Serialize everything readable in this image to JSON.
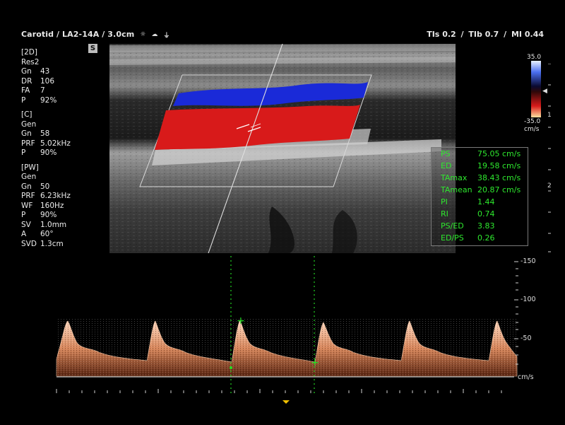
{
  "header": {
    "probe_info": "Carotid / LA2-14A / 3.0cm",
    "icons": [
      "harmonic-icon",
      "cloud-icon",
      "probe-icon"
    ],
    "indices": [
      {
        "label": "TIs",
        "value": "0.2"
      },
      {
        "label": "TIb",
        "value": "0.7"
      },
      {
        "label": "MI",
        "value": "0.44"
      }
    ]
  },
  "side_marker": "S",
  "params": [
    {
      "title": "[2D]",
      "preset": "Res2",
      "rows": [
        {
          "k": "Gn",
          "v": "43"
        },
        {
          "k": "DR",
          "v": "106"
        },
        {
          "k": "FA",
          "v": "7"
        },
        {
          "k": "P",
          "v": "92%"
        }
      ]
    },
    {
      "title": "[C]",
      "preset": "Gen",
      "rows": [
        {
          "k": "Gn",
          "v": "58"
        },
        {
          "k": "PRF",
          "v": "5.02kHz"
        },
        {
          "k": "P",
          "v": "90%"
        }
      ]
    },
    {
      "title": "[PW]",
      "preset": "Gen",
      "rows": [
        {
          "k": "Gn",
          "v": "50"
        },
        {
          "k": "PRF",
          "v": "6.23kHz"
        },
        {
          "k": "WF",
          "v": "160Hz"
        },
        {
          "k": "P",
          "v": "90%"
        },
        {
          "k": "SV",
          "v": "1.0mm"
        },
        {
          "k": "A",
          "v": "60°"
        },
        {
          "k": "SVD",
          "v": "1.3cm"
        }
      ]
    }
  ],
  "color_scale": {
    "top": "35.0",
    "bottom": "-35.0",
    "unit": "cm/s",
    "colors": {
      "positive": "#d81a1a",
      "negative": "#1a2ad8"
    }
  },
  "depth_marks": [
    "1",
    "2"
  ],
  "measurements": [
    {
      "name": "PS",
      "value": "75.05",
      "unit": "cm/s"
    },
    {
      "name": "ED",
      "value": "19.58",
      "unit": "cm/s"
    },
    {
      "name": "TAmax",
      "value": "38.43",
      "unit": "cm/s"
    },
    {
      "name": "TAmean",
      "value": "20.87",
      "unit": "cm/s"
    },
    {
      "name": "PI",
      "value": "1.44",
      "unit": ""
    },
    {
      "name": "RI",
      "value": "0.74",
      "unit": ""
    },
    {
      "name": "PS/ED",
      "value": "3.83",
      "unit": ""
    },
    {
      "name": "ED/PS",
      "value": "0.26",
      "unit": ""
    }
  ],
  "velocity_scale": {
    "labels": [
      "-150",
      "-100",
      "-50"
    ],
    "unit": "cm/s"
  },
  "colors": {
    "measure_text": "#2ee82e",
    "flow_red": "#d81a1a",
    "flow_blue": "#1a2ad8",
    "doppler": "#e9a07a"
  }
}
